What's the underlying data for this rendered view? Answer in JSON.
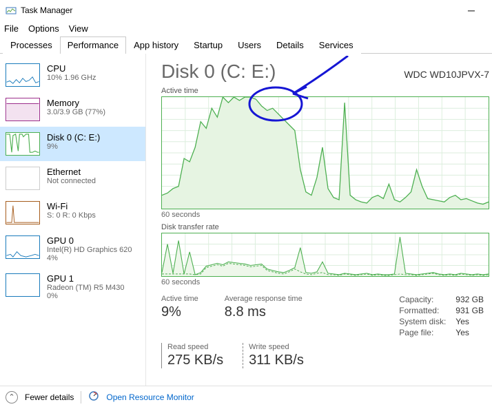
{
  "window": {
    "title": "Task Manager"
  },
  "menu": {
    "file": "File",
    "options": "Options",
    "view": "View"
  },
  "tabs": {
    "processes": "Processes",
    "performance": "Performance",
    "apphistory": "App history",
    "startup": "Startup",
    "users": "Users",
    "details": "Details",
    "services": "Services"
  },
  "sidebar": {
    "items": [
      {
        "name": "CPU",
        "sub": "10% 1.96 GHz"
      },
      {
        "name": "Memory",
        "sub": "3.0/3.9 GB (77%)"
      },
      {
        "name": "Disk 0 (C: E:)",
        "sub": "9%"
      },
      {
        "name": "Ethernet",
        "sub": "Not connected"
      },
      {
        "name": "Wi-Fi",
        "sub": "S: 0 R: 0 Kbps"
      },
      {
        "name": "GPU 0",
        "sub": "Intel(R) HD Graphics 620",
        "sub2": "4%"
      },
      {
        "name": "GPU 1",
        "sub": "Radeon (TM) R5 M430",
        "sub2": "0%"
      }
    ]
  },
  "detail": {
    "title": "Disk 0 (C: E:)",
    "model": "WDC WD10JPVX-7",
    "chart1_title": "Active time",
    "chart1_footer": "60 seconds",
    "chart2_title": "Disk transfer rate",
    "chart2_footer": "60 seconds",
    "active_time_lbl": "Active time",
    "active_time_val": "9%",
    "avg_resp_lbl": "Average response time",
    "avg_resp_val": "8.8 ms",
    "read_lbl": "Read speed",
    "read_val": "275 KB/s",
    "write_lbl": "Write speed",
    "write_val": "311 KB/s",
    "capacity_lbl": "Capacity:",
    "capacity_val": "932 GB",
    "formatted_lbl": "Formatted:",
    "formatted_val": "931 GB",
    "sysdisk_lbl": "System disk:",
    "sysdisk_val": "Yes",
    "pagefile_lbl": "Page file:",
    "pagefile_val": "Yes"
  },
  "footer": {
    "fewer": "Fewer details",
    "orm": "Open Resource Monitor"
  },
  "chart_data": [
    {
      "type": "area",
      "title": "Active time",
      "ylabel": "",
      "xlabel": "",
      "ylim": [
        0,
        100
      ],
      "x_seconds": 60,
      "values": [
        12,
        14,
        18,
        20,
        45,
        42,
        55,
        78,
        72,
        90,
        82,
        100,
        95,
        100,
        97,
        100,
        100,
        98,
        92,
        88,
        90,
        85,
        80,
        75,
        70,
        35,
        15,
        12,
        28,
        55,
        18,
        10,
        8,
        95,
        12,
        8,
        6,
        5,
        10,
        12,
        9,
        22,
        8,
        6,
        10,
        15,
        35,
        20,
        9,
        8,
        7,
        6,
        10,
        12,
        8,
        9,
        7,
        5,
        4,
        6
      ]
    },
    {
      "type": "line",
      "title": "Disk transfer rate",
      "ylabel": "",
      "xlabel": "",
      "x_seconds": 60,
      "series": [
        {
          "name": "read",
          "values": [
            5,
            45,
            4,
            50,
            3,
            34,
            2,
            5,
            14,
            16,
            18,
            16,
            20,
            19,
            18,
            17,
            15,
            16,
            17,
            10,
            8,
            6,
            5,
            8,
            12,
            40,
            5,
            4,
            6,
            20,
            4,
            3,
            2,
            4,
            3,
            2,
            3,
            4,
            2,
            3,
            2,
            2,
            3,
            55,
            4,
            3,
            2,
            3,
            4,
            5,
            3,
            2,
            3,
            2,
            4,
            3,
            2,
            3,
            2,
            3
          ]
        },
        {
          "name": "write",
          "values": [
            3,
            3,
            3,
            3,
            3,
            3,
            2,
            3,
            12,
            14,
            16,
            14,
            18,
            17,
            16,
            15,
            13,
            14,
            15,
            8,
            6,
            4,
            3,
            6,
            10,
            6,
            3,
            2,
            4,
            5,
            2,
            2,
            1,
            3,
            2,
            1,
            2,
            3,
            1,
            2,
            1,
            1,
            2,
            3,
            2,
            2,
            1,
            2,
            3,
            4,
            2,
            1,
            2,
            1,
            3,
            2,
            1,
            2,
            1,
            2
          ]
        }
      ]
    }
  ]
}
